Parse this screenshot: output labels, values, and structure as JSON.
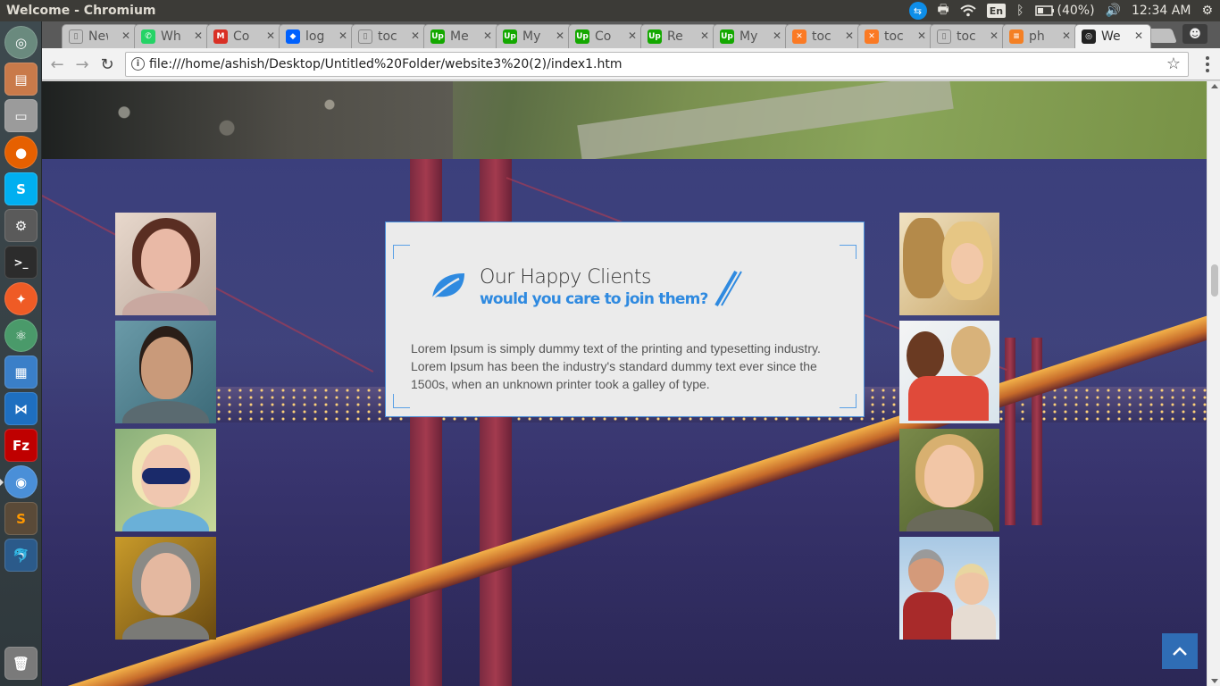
{
  "top_panel": {
    "window_title": "Welcome - Chromium",
    "keyboard_layout": "En",
    "battery": "(40%)",
    "clock": "12:34 AM"
  },
  "browser": {
    "tabs": [
      {
        "label": "New T",
        "favicon": "page-icon",
        "color": "#c6c6c6"
      },
      {
        "label": "Wh",
        "favicon": "whatsapp-icon",
        "color": "#25d366"
      },
      {
        "label": "Co",
        "favicon": "gmail-icon",
        "color": "#d93025"
      },
      {
        "label": "log",
        "favicon": "dropbox-icon",
        "color": "#0061fe"
      },
      {
        "label": "toc",
        "favicon": "page-icon",
        "color": "#888888"
      },
      {
        "label": "Me",
        "favicon": "upwork-icon",
        "color": "#14a800"
      },
      {
        "label": "My",
        "favicon": "upwork-icon",
        "color": "#14a800"
      },
      {
        "label": "Co",
        "favicon": "upwork-icon",
        "color": "#14a800"
      },
      {
        "label": "Re",
        "favicon": "upwork-icon",
        "color": "#14a800"
      },
      {
        "label": "My",
        "favicon": "upwork-icon",
        "color": "#14a800"
      },
      {
        "label": "toc",
        "favicon": "xampp-icon",
        "color": "#fb7a24"
      },
      {
        "label": "toc",
        "favicon": "xampp-icon",
        "color": "#fb7a24"
      },
      {
        "label": "toc",
        "favicon": "page-icon",
        "color": "#888888"
      },
      {
        "label": "ph",
        "favicon": "stackoverflow-icon",
        "color": "#f48024"
      },
      {
        "label": "We",
        "favicon": "chromium-welcome-icon",
        "color": "#222222"
      }
    ],
    "url": "file:///home/ashish/Desktop/Untitled%20Folder/website3%20(2)/index1.htm"
  },
  "page": {
    "testimonial": {
      "title": "Our Happy Clients",
      "subtitle": "would you care to join them?",
      "body": "Lorem Ipsum is simply dummy text of the printing and typesetting industry. Lorem Ipsum has been the industry's standard dummy text ever since the 1500s, when an unknown printer took a galley of type."
    },
    "accent_color": "#2f8ae0"
  }
}
